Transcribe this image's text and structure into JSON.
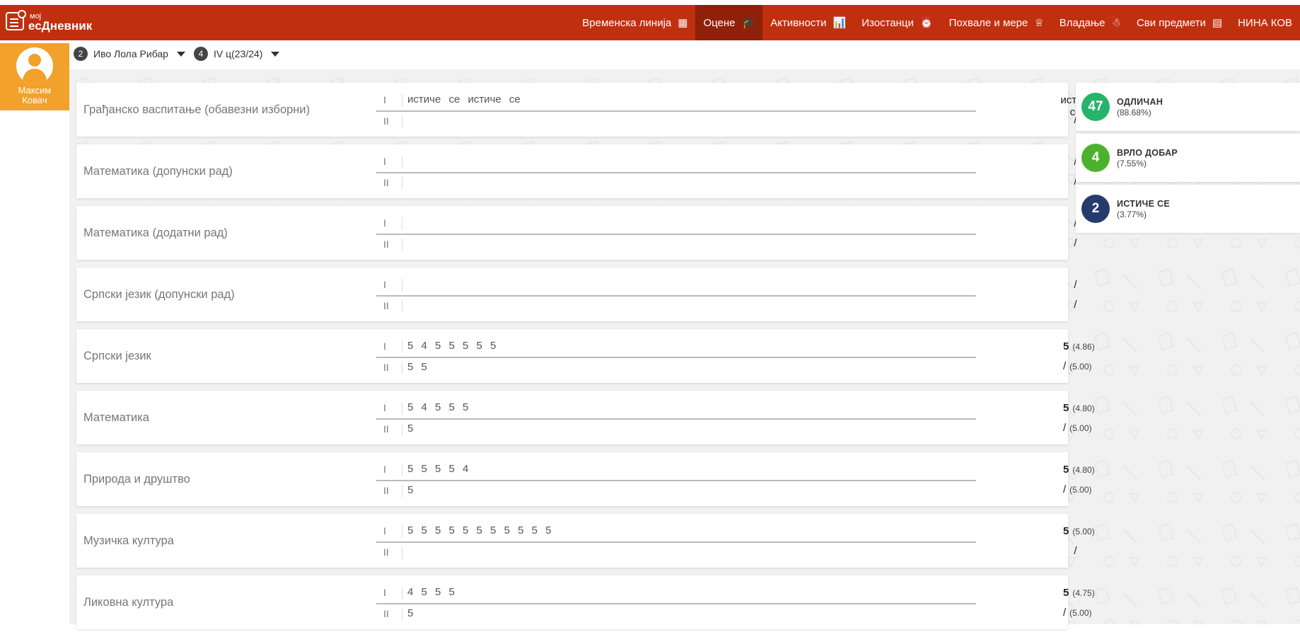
{
  "app": {
    "logo_small": "мој",
    "logo_big": "есДневник"
  },
  "nav": [
    {
      "label": "Временска линија",
      "icon": "▦",
      "icon_name": "calendar-icon",
      "active": false
    },
    {
      "label": "Оцене",
      "icon": "🎓",
      "icon_name": "graduation-cap-icon",
      "active": true
    },
    {
      "label": "Активности",
      "icon": "📊",
      "icon_name": "bar-chart-icon",
      "active": false
    },
    {
      "label": "Изостанци",
      "icon": "⏰",
      "icon_name": "alarm-clock-icon",
      "active": false
    },
    {
      "label": "Похвале и мере",
      "icon": "♕",
      "icon_name": "award-icon",
      "active": false
    },
    {
      "label": "Владање",
      "icon": "☃",
      "icon_name": "person-icon",
      "active": false
    },
    {
      "label": "Сви предмети",
      "icon": "▤",
      "icon_name": "teacher-board-icon",
      "active": false
    },
    {
      "label": "НИНА КОВ",
      "icon": "",
      "icon_name": "",
      "active": false
    }
  ],
  "student": {
    "first_name": "Максим",
    "last_name": "Ковач"
  },
  "selectors": [
    {
      "badge": "2",
      "label": "Иво Лола Рибар"
    },
    {
      "badge": "4",
      "label": "IV ц(23/24)"
    }
  ],
  "subjects": [
    {
      "name": "Грађанско васпитање (обавезни изборни)",
      "p1_label": "I",
      "p1": "истиче се  истиче се",
      "p2_label": "II",
      "p2": "",
      "final1": "истиче се",
      "avg1": "",
      "final2": "/",
      "avg2": ""
    },
    {
      "name": "Математика (допунски рад)",
      "p1_label": "I",
      "p1": "",
      "p2_label": "II",
      "p2": "",
      "final1": "/",
      "avg1": "",
      "final2": "/",
      "avg2": ""
    },
    {
      "name": "Математика (додатни рад)",
      "p1_label": "I",
      "p1": "",
      "p2_label": "II",
      "p2": "",
      "final1": "/",
      "avg1": "",
      "final2": "/",
      "avg2": ""
    },
    {
      "name": "Српски језик (допунски рад)",
      "p1_label": "I",
      "p1": "",
      "p2_label": "II",
      "p2": "",
      "final1": "/",
      "avg1": "",
      "final2": "/",
      "avg2": ""
    },
    {
      "name": "Српски језик",
      "p1_label": "I",
      "p1": "5 4 5 5 5 5 5",
      "p2_label": "II",
      "p2": "5 5",
      "final1": "5",
      "avg1": "(4.86)",
      "final2": "/",
      "avg2": "(5.00)"
    },
    {
      "name": "Математика",
      "p1_label": "I",
      "p1": "5 4 5 5 5",
      "p2_label": "II",
      "p2": "5",
      "final1": "5",
      "avg1": "(4.80)",
      "final2": "/",
      "avg2": "(5.00)"
    },
    {
      "name": "Природа и друштво",
      "p1_label": "I",
      "p1": "5 5 5 5 4",
      "p2_label": "II",
      "p2": "5",
      "final1": "5",
      "avg1": "(4.80)",
      "final2": "/",
      "avg2": "(5.00)"
    },
    {
      "name": "Музичка култура",
      "p1_label": "I",
      "p1": "5 5 5 5 5 5 5 5 5 5 5",
      "p2_label": "II",
      "p2": "",
      "final1": "5",
      "avg1": "(5.00)",
      "final2": "/",
      "avg2": ""
    },
    {
      "name": "Ликовна култура",
      "p1_label": "I",
      "p1": "4 5 5 5",
      "p2_label": "II",
      "p2": "5",
      "final1": "5",
      "avg1": "(4.75)",
      "final2": "/",
      "avg2": "(5.00)"
    }
  ],
  "stats": [
    {
      "count": "47",
      "label": "ОДЛИЧАН",
      "pct": "(88.68%)",
      "color": "#27b36a"
    },
    {
      "count": "4",
      "label": "ВРЛО ДОБАР",
      "pct": "(7.55%)",
      "color": "#4cb22e"
    },
    {
      "count": "2",
      "label": "ИСТИЧЕ СЕ",
      "pct": "(3.77%)",
      "color": "#263a6b"
    }
  ]
}
